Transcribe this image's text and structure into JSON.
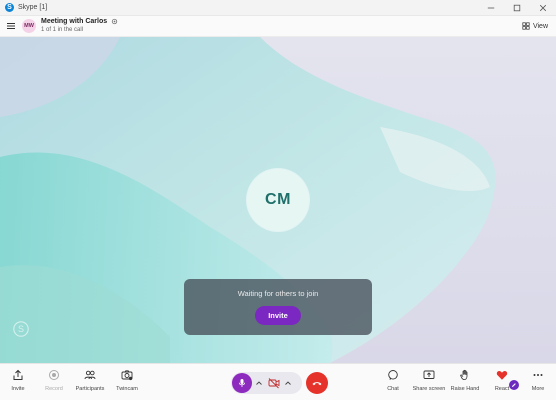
{
  "window": {
    "title": "Skype [1]"
  },
  "header": {
    "avatar_initials": "MW",
    "meeting_title": "Meeting with Carlos",
    "meeting_subtitle": "1 of 1 in the call",
    "view_label": "View"
  },
  "stage": {
    "participant_initials": "CM",
    "waiting_text": "Waiting for others to join",
    "invite_label": "Invite"
  },
  "toolbar": {
    "invite": "Invite",
    "record": "Record",
    "participants": "Participants",
    "twincam": "Twincam",
    "chat": "Chat",
    "share_screen": "Share screen",
    "raise_hand": "Raise Hand",
    "react": "React",
    "more": "More"
  },
  "colors": {
    "accent_purple": "#7b27c1",
    "end_call_red": "#e5322b",
    "react_heart": "#e5322b"
  },
  "icons": [
    "skype-icon",
    "minimize-icon",
    "maximize-icon",
    "close-icon",
    "menu-icon",
    "gear-icon",
    "view-grid-icon",
    "share-icon",
    "record-icon",
    "participants-icon",
    "twincam-icon",
    "microphone-icon",
    "chevron-up-icon",
    "camera-off-icon",
    "end-call-icon",
    "chat-icon",
    "share-screen-icon",
    "raise-hand-icon",
    "heart-icon",
    "pencil-icon",
    "more-icon"
  ]
}
